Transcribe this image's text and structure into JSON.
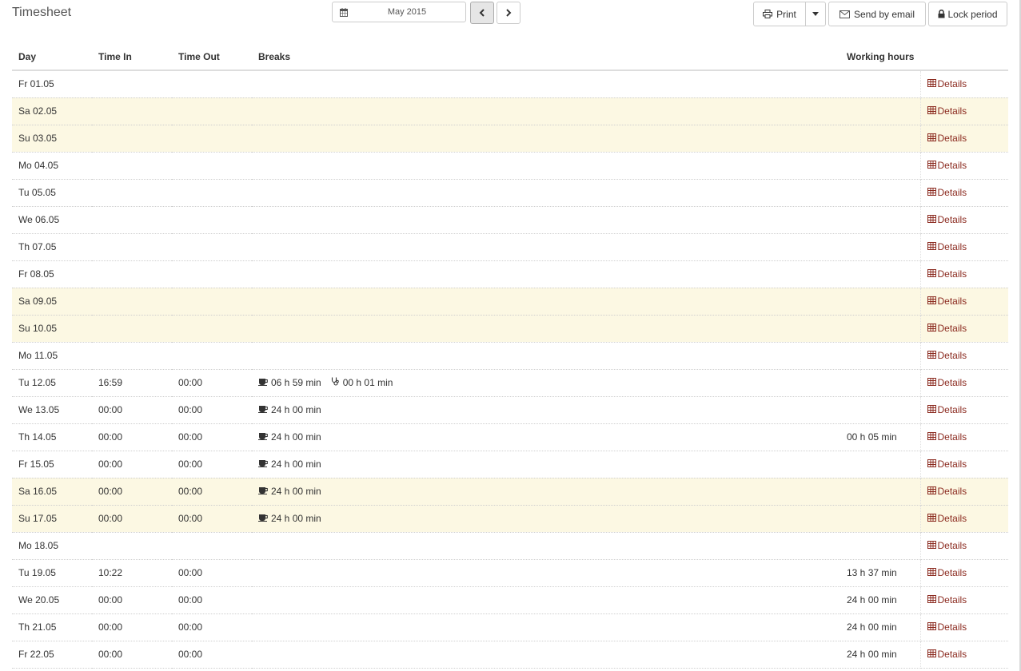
{
  "header": {
    "title": "Timesheet",
    "period": "May 2015",
    "print_label": "Print",
    "email_label": "Send by email",
    "lock_label": "Lock period"
  },
  "columns": [
    "Day",
    "Time In",
    "Time Out",
    "Breaks",
    "Working hours",
    ""
  ],
  "details_label": "Details",
  "colors": {
    "weekend_bg": "#fcf8e3",
    "link": "#8b2a1f"
  },
  "rows": [
    {
      "day": "Fr 01.05",
      "in": "",
      "out": "",
      "breaks": [],
      "hours": "",
      "weekend": false
    },
    {
      "day": "Sa 02.05",
      "in": "",
      "out": "",
      "breaks": [],
      "hours": "",
      "weekend": true
    },
    {
      "day": "Su 03.05",
      "in": "",
      "out": "",
      "breaks": [],
      "hours": "",
      "weekend": true
    },
    {
      "day": "Mo 04.05",
      "in": "",
      "out": "",
      "breaks": [],
      "hours": "",
      "weekend": false
    },
    {
      "day": "Tu 05.05",
      "in": "",
      "out": "",
      "breaks": [],
      "hours": "",
      "weekend": false
    },
    {
      "day": "We 06.05",
      "in": "",
      "out": "",
      "breaks": [],
      "hours": "",
      "weekend": false
    },
    {
      "day": "Th 07.05",
      "in": "",
      "out": "",
      "breaks": [],
      "hours": "",
      "weekend": false
    },
    {
      "day": "Fr 08.05",
      "in": "",
      "out": "",
      "breaks": [],
      "hours": "",
      "weekend": false
    },
    {
      "day": "Sa 09.05",
      "in": "",
      "out": "",
      "breaks": [],
      "hours": "",
      "weekend": true
    },
    {
      "day": "Su 10.05",
      "in": "",
      "out": "",
      "breaks": [],
      "hours": "",
      "weekend": true
    },
    {
      "day": "Mo 11.05",
      "in": "",
      "out": "",
      "breaks": [],
      "hours": "",
      "weekend": false
    },
    {
      "day": "Tu 12.05",
      "in": "16:59",
      "out": "00:00",
      "breaks": [
        {
          "icon": "coffee-icon",
          "text": "06 h 59 min"
        },
        {
          "icon": "stethoscope-icon",
          "text": "00 h 01 min"
        }
      ],
      "hours": "",
      "weekend": false
    },
    {
      "day": "We 13.05",
      "in": "00:00",
      "out": "00:00",
      "breaks": [
        {
          "icon": "coffee-icon",
          "text": "24 h 00 min"
        }
      ],
      "hours": "",
      "weekend": false
    },
    {
      "day": "Th 14.05",
      "in": "00:00",
      "out": "00:00",
      "breaks": [
        {
          "icon": "coffee-icon",
          "text": "24 h 00 min"
        }
      ],
      "hours": "00 h 05 min",
      "weekend": false
    },
    {
      "day": "Fr 15.05",
      "in": "00:00",
      "out": "00:00",
      "breaks": [
        {
          "icon": "coffee-icon",
          "text": "24 h 00 min"
        }
      ],
      "hours": "",
      "weekend": false
    },
    {
      "day": "Sa 16.05",
      "in": "00:00",
      "out": "00:00",
      "breaks": [
        {
          "icon": "coffee-icon",
          "text": "24 h 00 min"
        }
      ],
      "hours": "",
      "weekend": true
    },
    {
      "day": "Su 17.05",
      "in": "00:00",
      "out": "00:00",
      "breaks": [
        {
          "icon": "coffee-icon",
          "text": "24 h 00 min"
        }
      ],
      "hours": "",
      "weekend": true
    },
    {
      "day": "Mo 18.05",
      "in": "",
      "out": "",
      "breaks": [],
      "hours": "",
      "weekend": false
    },
    {
      "day": "Tu 19.05",
      "in": "10:22",
      "out": "00:00",
      "breaks": [],
      "hours": "13 h 37 min",
      "weekend": false
    },
    {
      "day": "We 20.05",
      "in": "00:00",
      "out": "00:00",
      "breaks": [],
      "hours": "24 h 00 min",
      "weekend": false
    },
    {
      "day": "Th 21.05",
      "in": "00:00",
      "out": "00:00",
      "breaks": [],
      "hours": "24 h 00 min",
      "weekend": false
    },
    {
      "day": "Fr 22.05",
      "in": "00:00",
      "out": "00:00",
      "breaks": [],
      "hours": "24 h 00 min",
      "weekend": false
    }
  ]
}
